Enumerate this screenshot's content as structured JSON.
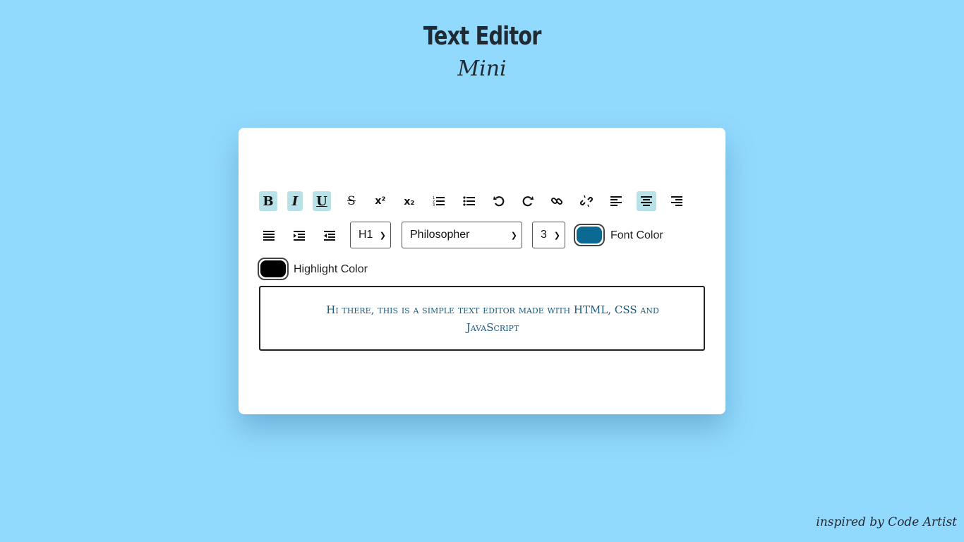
{
  "header": {
    "title": "Text Editor",
    "subtitle": "Mini"
  },
  "toolbar": {
    "row1": [
      {
        "name": "bold-button",
        "icon": "bold-icon",
        "glyph": "B",
        "active": true
      },
      {
        "name": "italic-button",
        "icon": "italic-icon",
        "glyph": "I",
        "active": true
      },
      {
        "name": "underline-button",
        "icon": "underline-icon",
        "glyph": "U",
        "active": true
      },
      {
        "name": "strikethrough-button",
        "icon": "strikethrough-icon",
        "glyph": "S",
        "active": false
      },
      {
        "name": "superscript-button",
        "icon": "superscript-icon",
        "glyph": "x²",
        "active": false
      },
      {
        "name": "subscript-button",
        "icon": "subscript-icon",
        "glyph": "x₂",
        "active": false
      },
      {
        "name": "ordered-list-button",
        "icon": "ordered-list-icon",
        "active": false
      },
      {
        "name": "unordered-list-button",
        "icon": "unordered-list-icon",
        "active": false
      },
      {
        "name": "undo-button",
        "icon": "undo-icon",
        "active": false
      },
      {
        "name": "redo-button",
        "icon": "redo-icon",
        "active": false
      },
      {
        "name": "link-button",
        "icon": "link-icon",
        "active": false
      },
      {
        "name": "unlink-button",
        "icon": "unlink-icon",
        "active": false
      },
      {
        "name": "align-left-button",
        "icon": "align-left-icon",
        "active": false
      },
      {
        "name": "align-center-button",
        "icon": "align-center-icon",
        "active": true
      },
      {
        "name": "align-right-button",
        "icon": "align-right-icon",
        "active": false
      }
    ],
    "row2": [
      {
        "name": "justify-button",
        "icon": "align-justify-icon",
        "active": false
      },
      {
        "name": "indent-button",
        "icon": "indent-icon",
        "active": false
      },
      {
        "name": "outdent-button",
        "icon": "outdent-icon",
        "active": false
      }
    ],
    "heading_select": {
      "value": "H1"
    },
    "font_select": {
      "value": "Philosopher"
    },
    "size_select": {
      "value": "3"
    },
    "font_color": {
      "label": "Font Color",
      "color": "#0b6a94"
    },
    "highlight_color": {
      "label": "Highlight Color",
      "color": "#000000"
    }
  },
  "editor": {
    "content": "Hi there, this is a simple text editor made with HTML, CSS and JavaScript",
    "text_color": "#1b5a7f"
  },
  "footer": {
    "credit": "inspired by Code Artist"
  },
  "colors": {
    "background": "#92d9fe",
    "active_button": "#b8e2e8"
  }
}
